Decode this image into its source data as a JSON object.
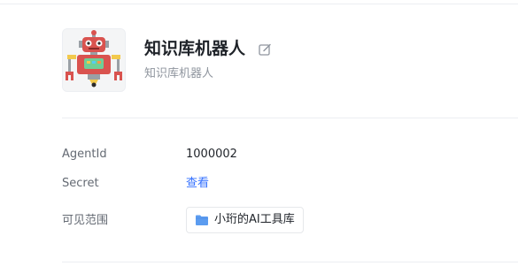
{
  "app": {
    "name": "知识库机器人",
    "description": "知识库机器人",
    "avatar_icon": "robot-icon",
    "edit_icon": "edit-icon"
  },
  "fields": {
    "agent_id_label": "AgentId",
    "agent_id_value": "1000002",
    "secret_label": "Secret",
    "secret_action": "查看",
    "scope_label": "可见范围",
    "scope_value": "小珩的AI工具库",
    "scope_icon": "folder-icon"
  },
  "colors": {
    "link": "#3370ff",
    "folder": "#5b9cf0",
    "robot_body": "#d9534f"
  }
}
